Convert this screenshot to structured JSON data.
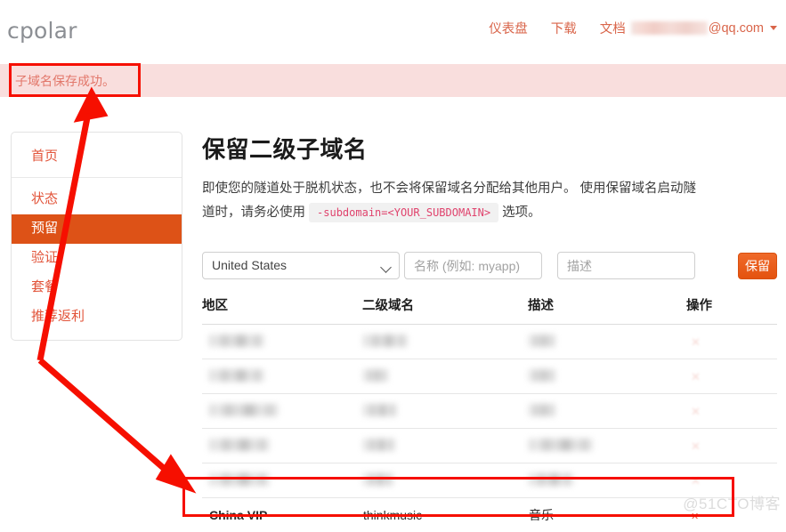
{
  "header": {
    "logo": "cpolar",
    "nav": [
      {
        "label": "仪表盘",
        "name": "nav-dashboard"
      },
      {
        "label": "下载",
        "name": "nav-download"
      },
      {
        "label": "文档",
        "name": "nav-docs"
      }
    ],
    "user_email_suffix": "@qq.com",
    "user_email_blurred": true
  },
  "alert": {
    "message": "子域名保存成功。",
    "background_color": "#f9dedd",
    "text_color": "#e2776a"
  },
  "sidebar": {
    "home": {
      "label": "首页",
      "active": false
    },
    "items": [
      {
        "label": "状态",
        "active": false
      },
      {
        "label": "预留",
        "active": true
      },
      {
        "label": "验证",
        "active": false
      },
      {
        "label": "套餐",
        "active": false
      },
      {
        "label": "推荐返利",
        "active": false
      }
    ],
    "active_color": "#dd5217",
    "link_color": "#e2543a"
  },
  "main": {
    "title": "保留二级子域名",
    "description_part1": "即使您的隧道处于脱机状态，也不会将保留域名分配给其他用户。 使用保留域名启动隧道时，请务必使用",
    "description_code": "-subdomain=<YOUR_SUBDOMAIN>",
    "description_part2": "选项。",
    "form": {
      "region_value": "United States",
      "name_placeholder": "名称 (例如: myapp)",
      "desc_placeholder": "描述",
      "name_value": "",
      "desc_value": "",
      "submit_label": "保留",
      "submit_color": "#e4520f"
    },
    "table": {
      "headers": [
        "地区",
        "二级域名",
        "描述",
        "操作"
      ],
      "rows": [
        {
          "region": "",
          "subdomain": "",
          "desc": "",
          "blurred": true,
          "widths": [
            62,
            50,
            30
          ]
        },
        {
          "region": "",
          "subdomain": "",
          "desc": "",
          "blurred": true,
          "widths": [
            62,
            28,
            30
          ]
        },
        {
          "region": "",
          "subdomain": "",
          "desc": "",
          "blurred": true,
          "widths": [
            78,
            38,
            30
          ]
        },
        {
          "region": "",
          "subdomain": "",
          "desc": "",
          "blurred": true,
          "widths": [
            68,
            36,
            72
          ]
        },
        {
          "region": "",
          "subdomain": "",
          "desc": "",
          "blurred": true,
          "widths": [
            68,
            34,
            50
          ]
        },
        {
          "region": "China VIP",
          "subdomain": "thinkmusic",
          "desc": "音乐",
          "blurred": false,
          "delete_label": "✕"
        }
      ]
    }
  },
  "annotations": {
    "highlight_color": "#f60f00",
    "boxes": [
      "alert-success-box",
      "china-vip-row-box"
    ],
    "arrow": "double-headed-arrow-from-row-to-alert"
  },
  "watermark": "@51CTO博客"
}
